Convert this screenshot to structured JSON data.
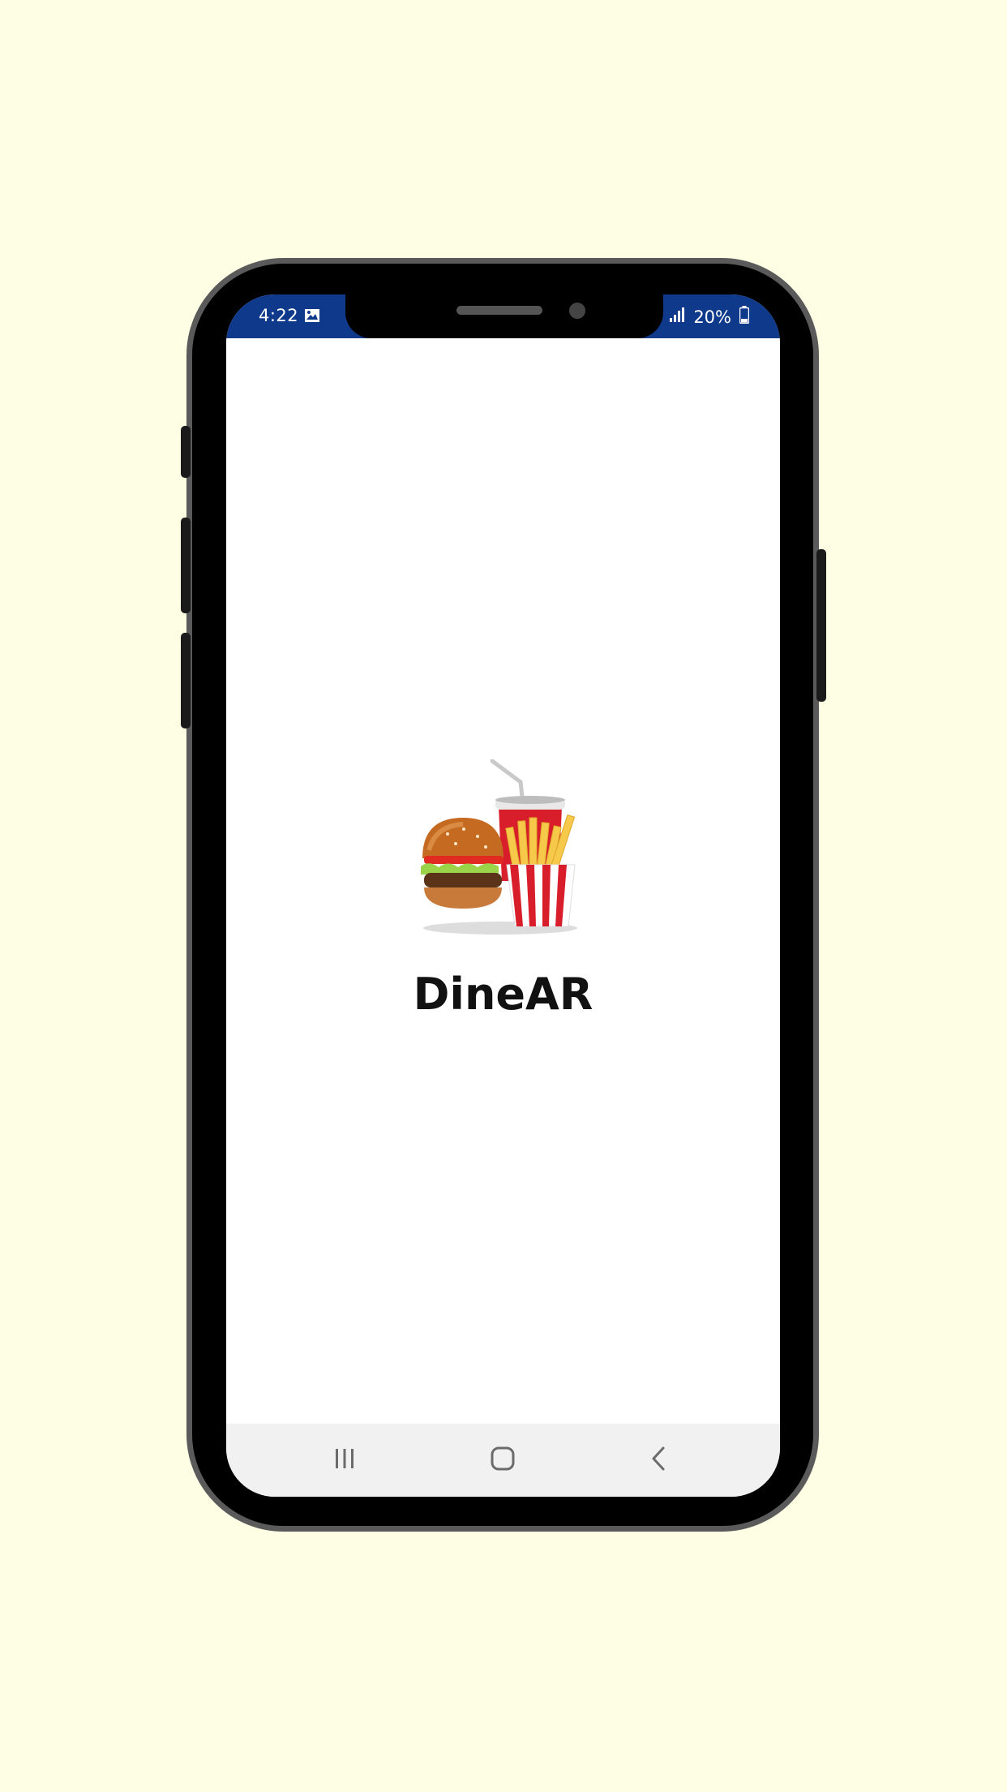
{
  "status_bar": {
    "time": "4:22",
    "battery": "20%",
    "gallery_icon": "image-icon",
    "signal_icon": "signal-icon",
    "battery_icon": "battery-icon",
    "background": "#0f3a8c"
  },
  "splash": {
    "app_name": "DineAR",
    "logo_icon": "burger-fries-drink-icon"
  },
  "nav_bar": {
    "recents_icon": "recents-icon",
    "home_icon": "home-icon",
    "back_icon": "back-icon"
  },
  "colors": {
    "page_background": "#fefee4",
    "phone_frame": "#000000",
    "phone_border": "#5a5a5a"
  }
}
